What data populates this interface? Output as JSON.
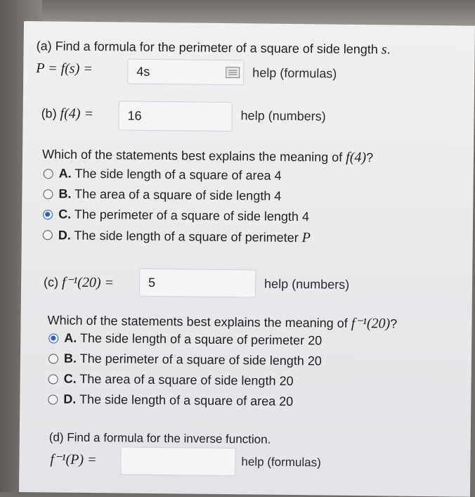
{
  "part_a": {
    "question": "(a) Find a formula for the perimeter of a square of side length ",
    "var_s": "s",
    "period": ".",
    "lhs": "P = f(s) = ",
    "input_value": "4s",
    "help": "help (formulas)"
  },
  "part_b": {
    "lhs_prefix": "(b) ",
    "lhs": "f(4) = ",
    "input_value": "16",
    "help": "help (numbers)",
    "question": "Which of the statements best explains the meaning of ",
    "question_math": "f(4)",
    "question_end": "?",
    "options": [
      {
        "letter": "A.",
        "text": " The side length of a square of area 4",
        "selected": false
      },
      {
        "letter": "B.",
        "text": " The area of a square of side length 4",
        "selected": false
      },
      {
        "letter": "C.",
        "text": " The perimeter of a square of side length 4",
        "selected": true
      },
      {
        "letter": "D.",
        "text": " The side length of a square of perimeter ",
        "math": "P",
        "selected": false
      }
    ]
  },
  "part_c": {
    "lhs_prefix": "(c) ",
    "lhs": "f⁻¹(20) = ",
    "input_value": "5",
    "help": "help (numbers)",
    "question": "Which of the statements best explains the meaning of ",
    "question_math": "f⁻¹(20)",
    "question_end": "?",
    "options": [
      {
        "letter": "A.",
        "text": " The side length of a square of perimeter 20",
        "selected": true
      },
      {
        "letter": "B.",
        "text": " The perimeter of a square of side length 20",
        "selected": false
      },
      {
        "letter": "C.",
        "text": " The area of a square of side length 20",
        "selected": false
      },
      {
        "letter": "D.",
        "text": " The side length of a square of area 20",
        "selected": false
      }
    ]
  },
  "part_d": {
    "question": "(d) Find a formula for the inverse function.",
    "lhs": "f⁻¹(P) = ",
    "input_value": "",
    "help": "help (formulas)"
  },
  "colors": {
    "selected_radio": "#2f62b6",
    "paper": "#ececef"
  }
}
